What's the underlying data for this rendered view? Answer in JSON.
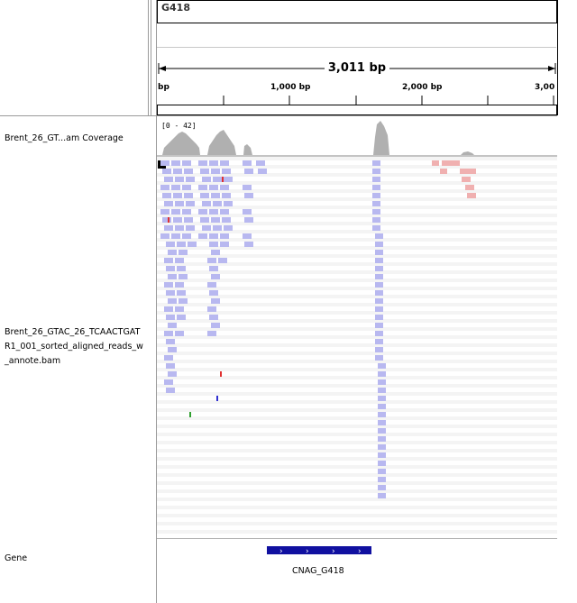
{
  "header": {
    "locus": "G418",
    "span_label": "3,011 bp",
    "ruler_ticks": [
      {
        "label": "bp"
      },
      {
        "label": "1,000 bp"
      },
      {
        "label": "2,000 bp"
      },
      {
        "label": "3,00"
      }
    ]
  },
  "tracks": {
    "coverage": {
      "name": "Brent_26_GT...am Coverage",
      "range_label": "[0 - 42]"
    },
    "alignment": {
      "name_lines": [
        "Brent_26_GTAC_26_TCAACTGAT",
        "R1_001_sorted_aligned_reads_w",
        "_annote.bam"
      ]
    },
    "gene": {
      "name": "Gene",
      "feature_label": "CNAG_G418",
      "strand_glyph": "›"
    }
  },
  "colors": {
    "coverage_fill": "#b0b0b0",
    "read_fill": "#b8b8f0",
    "read_pink": "#f0b0b0",
    "gene_fill": "#1010a0",
    "mismatch_red": "#e03030",
    "mismatch_blue": "#3030d0",
    "mismatch_green": "#30a030"
  }
}
